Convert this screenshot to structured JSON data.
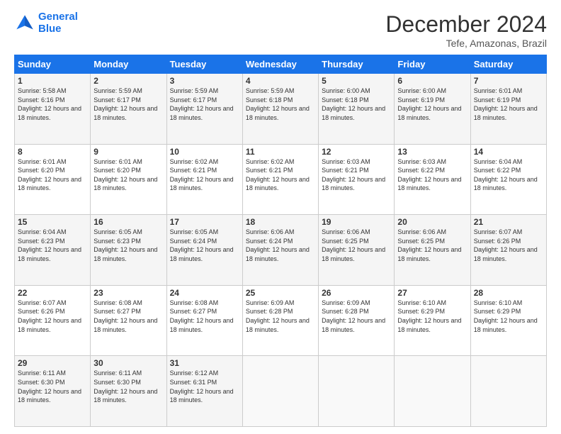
{
  "header": {
    "logo_line1": "General",
    "logo_line2": "Blue",
    "month": "December 2024",
    "location": "Tefe, Amazonas, Brazil"
  },
  "weekdays": [
    "Sunday",
    "Monday",
    "Tuesday",
    "Wednesday",
    "Thursday",
    "Friday",
    "Saturday"
  ],
  "weeks": [
    [
      {
        "day": "1",
        "info": "Sunrise: 5:58 AM\nSunset: 6:16 PM\nDaylight: 12 hours and 18 minutes."
      },
      {
        "day": "2",
        "info": "Sunrise: 5:59 AM\nSunset: 6:17 PM\nDaylight: 12 hours and 18 minutes."
      },
      {
        "day": "3",
        "info": "Sunrise: 5:59 AM\nSunset: 6:17 PM\nDaylight: 12 hours and 18 minutes."
      },
      {
        "day": "4",
        "info": "Sunrise: 5:59 AM\nSunset: 6:18 PM\nDaylight: 12 hours and 18 minutes."
      },
      {
        "day": "5",
        "info": "Sunrise: 6:00 AM\nSunset: 6:18 PM\nDaylight: 12 hours and 18 minutes."
      },
      {
        "day": "6",
        "info": "Sunrise: 6:00 AM\nSunset: 6:19 PM\nDaylight: 12 hours and 18 minutes."
      },
      {
        "day": "7",
        "info": "Sunrise: 6:01 AM\nSunset: 6:19 PM\nDaylight: 12 hours and 18 minutes."
      }
    ],
    [
      {
        "day": "8",
        "info": "Sunrise: 6:01 AM\nSunset: 6:20 PM\nDaylight: 12 hours and 18 minutes."
      },
      {
        "day": "9",
        "info": "Sunrise: 6:01 AM\nSunset: 6:20 PM\nDaylight: 12 hours and 18 minutes."
      },
      {
        "day": "10",
        "info": "Sunrise: 6:02 AM\nSunset: 6:21 PM\nDaylight: 12 hours and 18 minutes."
      },
      {
        "day": "11",
        "info": "Sunrise: 6:02 AM\nSunset: 6:21 PM\nDaylight: 12 hours and 18 minutes."
      },
      {
        "day": "12",
        "info": "Sunrise: 6:03 AM\nSunset: 6:21 PM\nDaylight: 12 hours and 18 minutes."
      },
      {
        "day": "13",
        "info": "Sunrise: 6:03 AM\nSunset: 6:22 PM\nDaylight: 12 hours and 18 minutes."
      },
      {
        "day": "14",
        "info": "Sunrise: 6:04 AM\nSunset: 6:22 PM\nDaylight: 12 hours and 18 minutes."
      }
    ],
    [
      {
        "day": "15",
        "info": "Sunrise: 6:04 AM\nSunset: 6:23 PM\nDaylight: 12 hours and 18 minutes."
      },
      {
        "day": "16",
        "info": "Sunrise: 6:05 AM\nSunset: 6:23 PM\nDaylight: 12 hours and 18 minutes."
      },
      {
        "day": "17",
        "info": "Sunrise: 6:05 AM\nSunset: 6:24 PM\nDaylight: 12 hours and 18 minutes."
      },
      {
        "day": "18",
        "info": "Sunrise: 6:06 AM\nSunset: 6:24 PM\nDaylight: 12 hours and 18 minutes."
      },
      {
        "day": "19",
        "info": "Sunrise: 6:06 AM\nSunset: 6:25 PM\nDaylight: 12 hours and 18 minutes."
      },
      {
        "day": "20",
        "info": "Sunrise: 6:06 AM\nSunset: 6:25 PM\nDaylight: 12 hours and 18 minutes."
      },
      {
        "day": "21",
        "info": "Sunrise: 6:07 AM\nSunset: 6:26 PM\nDaylight: 12 hours and 18 minutes."
      }
    ],
    [
      {
        "day": "22",
        "info": "Sunrise: 6:07 AM\nSunset: 6:26 PM\nDaylight: 12 hours and 18 minutes."
      },
      {
        "day": "23",
        "info": "Sunrise: 6:08 AM\nSunset: 6:27 PM\nDaylight: 12 hours and 18 minutes."
      },
      {
        "day": "24",
        "info": "Sunrise: 6:08 AM\nSunset: 6:27 PM\nDaylight: 12 hours and 18 minutes."
      },
      {
        "day": "25",
        "info": "Sunrise: 6:09 AM\nSunset: 6:28 PM\nDaylight: 12 hours and 18 minutes."
      },
      {
        "day": "26",
        "info": "Sunrise: 6:09 AM\nSunset: 6:28 PM\nDaylight: 12 hours and 18 minutes."
      },
      {
        "day": "27",
        "info": "Sunrise: 6:10 AM\nSunset: 6:29 PM\nDaylight: 12 hours and 18 minutes."
      },
      {
        "day": "28",
        "info": "Sunrise: 6:10 AM\nSunset: 6:29 PM\nDaylight: 12 hours and 18 minutes."
      }
    ],
    [
      {
        "day": "29",
        "info": "Sunrise: 6:11 AM\nSunset: 6:30 PM\nDaylight: 12 hours and 18 minutes."
      },
      {
        "day": "30",
        "info": "Sunrise: 6:11 AM\nSunset: 6:30 PM\nDaylight: 12 hours and 18 minutes."
      },
      {
        "day": "31",
        "info": "Sunrise: 6:12 AM\nSunset: 6:31 PM\nDaylight: 12 hours and 18 minutes."
      },
      null,
      null,
      null,
      null
    ]
  ]
}
